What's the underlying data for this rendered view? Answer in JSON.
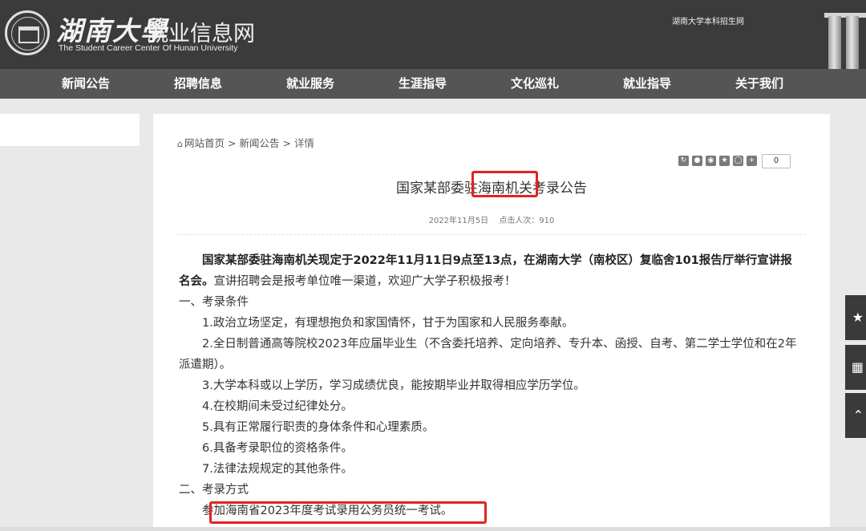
{
  "header": {
    "calligraphy": "湖南大學",
    "site_title": "就业信息网",
    "subtitle": "The Student Career Center Of Hunan University",
    "top_link": "湖南大学本科招生网"
  },
  "nav": [
    {
      "label": "新闻公告"
    },
    {
      "label": "招聘信息"
    },
    {
      "label": "就业服务"
    },
    {
      "label": "生涯指导"
    },
    {
      "label": "文化巡礼"
    },
    {
      "label": "就业指导"
    },
    {
      "label": "关于我们"
    }
  ],
  "breadcrumb": {
    "home": "网站首页",
    "sep": ">",
    "section": "新闻公告",
    "current": "详情"
  },
  "share": {
    "icons": [
      "share-icon",
      "user-icon",
      "weibo-icon",
      "star-icon",
      "qzone-icon",
      "plus-icon"
    ],
    "count": "0"
  },
  "article": {
    "title": "国家某部委驻海南机关考录公告",
    "date": "2022年11月5日",
    "views": "点击人次：910",
    "lead_bold": "国家某部委驻海南机关现定于2022年11月11日9点至13点，在湖南大学（南校区）复临舍101报告厅举行宣讲报名会。",
    "lead_rest": "宣讲招聘会是报考单位唯一渠道，欢迎广大学子积极报考！",
    "section1": "一、考录条件",
    "items": [
      "1.政治立场坚定，有理想抱负和家国情怀，甘于为国家和人民服务奉献。",
      "2.全日制普通高等院校2023年应届毕业生（不含委托培养、定向培养、专升本、函授、自考、第二学士学位和在2年派遣期）。",
      "3.大学本科或以上学历，学习成绩优良，能按期毕业并取得相应学历学位。",
      "4.在校期间未受过纪律处分。",
      "5.具有正常履行职责的身体条件和心理素质。",
      "6.具备考录职位的资格条件。",
      "7.法律法规规定的其他条件。"
    ],
    "section2": "二、考录方式",
    "method": "参加海南省2023年度考试录用公务员统一考试。"
  },
  "side_buttons": [
    "star-icon",
    "qrcode-icon",
    "back-to-top-icon"
  ],
  "colors": {
    "header_bg": "#3b3b3b",
    "nav_bg": "#555555",
    "highlight": "#e32222"
  }
}
